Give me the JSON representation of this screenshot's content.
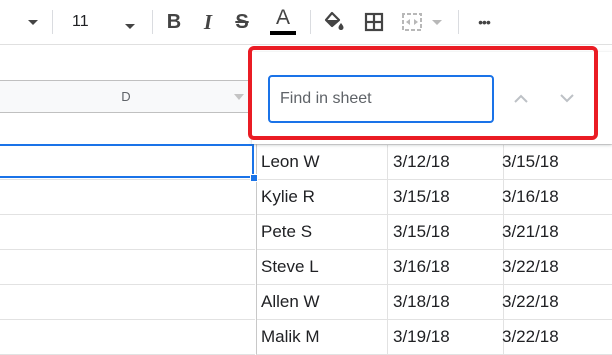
{
  "toolbar": {
    "font_size": "11",
    "icons": [
      "dropdown-arrow",
      "font-size-dropdown",
      "bold",
      "italic",
      "strikethrough",
      "text-color",
      "fill-color",
      "borders",
      "merge-cells",
      "more"
    ],
    "bold_label": "B",
    "italic_label": "I",
    "strike_label": "S",
    "textcolor_label": "A",
    "more_label": "•••"
  },
  "column_header": {
    "label": "D"
  },
  "find": {
    "placeholder": "Find in sheet"
  },
  "rows": [
    {
      "name": "Leon W",
      "date1": "3/12/18",
      "date2": "3/15/18"
    },
    {
      "name": "Kylie R",
      "date1": "3/15/18",
      "date2": "3/16/18"
    },
    {
      "name": "Pete S",
      "date1": "3/15/18",
      "date2": "3/21/18"
    },
    {
      "name": "Steve L",
      "date1": "3/16/18",
      "date2": "3/22/18"
    },
    {
      "name": "Allen W",
      "date1": "3/18/18",
      "date2": "3/22/18"
    },
    {
      "name": "Malik M",
      "date1": "3/19/18",
      "date2": "3/22/18"
    }
  ],
  "colors": {
    "accent": "#1a73e8",
    "highlight": "#ea1c24"
  }
}
